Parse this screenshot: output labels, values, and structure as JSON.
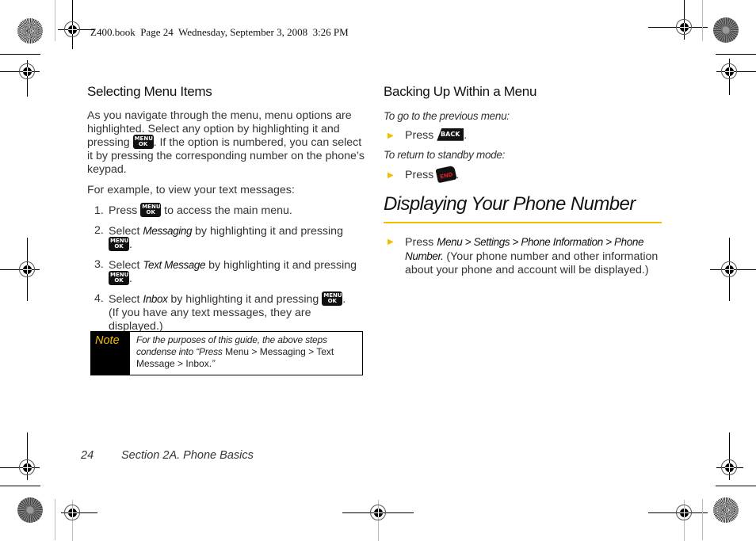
{
  "header": {
    "print_info": "Z400.book  Page 24  Wednesday, September 3, 2008  3:26 PM"
  },
  "left_column": {
    "heading": "Selecting Menu Items",
    "intro": {
      "before_key": "As you navigate through the menu, menu options are highlighted. Select any option by highlighting it and pressing",
      "after_key": ". If the option is numbered, you can select it by pressing the corresponding number on the phone’s keypad."
    },
    "example_intro": "For example, to view your text messages:",
    "steps": [
      {
        "num": "1.",
        "before": "Press",
        "emph": "",
        "after": "to access the main menu.",
        "key_position": "middle"
      },
      {
        "num": "2.",
        "before": "Select",
        "emph": "Messaging",
        "after": "by highlighting it and pressing",
        "key_position": "end"
      },
      {
        "num": "3.",
        "before": "Select",
        "emph": "Text Message",
        "after": "by highlighting it and pressing",
        "key_position": "end"
      },
      {
        "num": "4.",
        "before": "Select",
        "emph": "Inbox",
        "after": "by highlighting it and pressing",
        "tail": "(If you have any text messages, they are displayed.)",
        "key_position": "end"
      }
    ],
    "note": {
      "label": "Note",
      "text_italic": "For the purposes of this guide, the above steps condense into “Press",
      "path": "Menu > Messaging > Text Message > Inbox.",
      "close": "”"
    }
  },
  "right_column": {
    "heading": "Backing Up Within a Menu",
    "prev_label": "To go to the previous menu:",
    "prev_press": "Press",
    "standby_label": "To return to standby mode:",
    "standby_press": "Press",
    "section_title": "Displaying Your Phone Number",
    "phone_press": "Press",
    "phone_path": "Menu > Settings > Phone Information > Phone Number.",
    "phone_desc": "(Your phone number and other information about your phone and account will be displayed.)"
  },
  "keys": {
    "menu_ok": {
      "top": "MENU",
      "bottom": "OK"
    },
    "back": "BACK",
    "end": "END"
  },
  "footer": {
    "page_number": "24",
    "section": "Section 2A. Phone Basics"
  },
  "colors": {
    "accent": "#f0c000",
    "end_key_text": "#e0202a"
  }
}
